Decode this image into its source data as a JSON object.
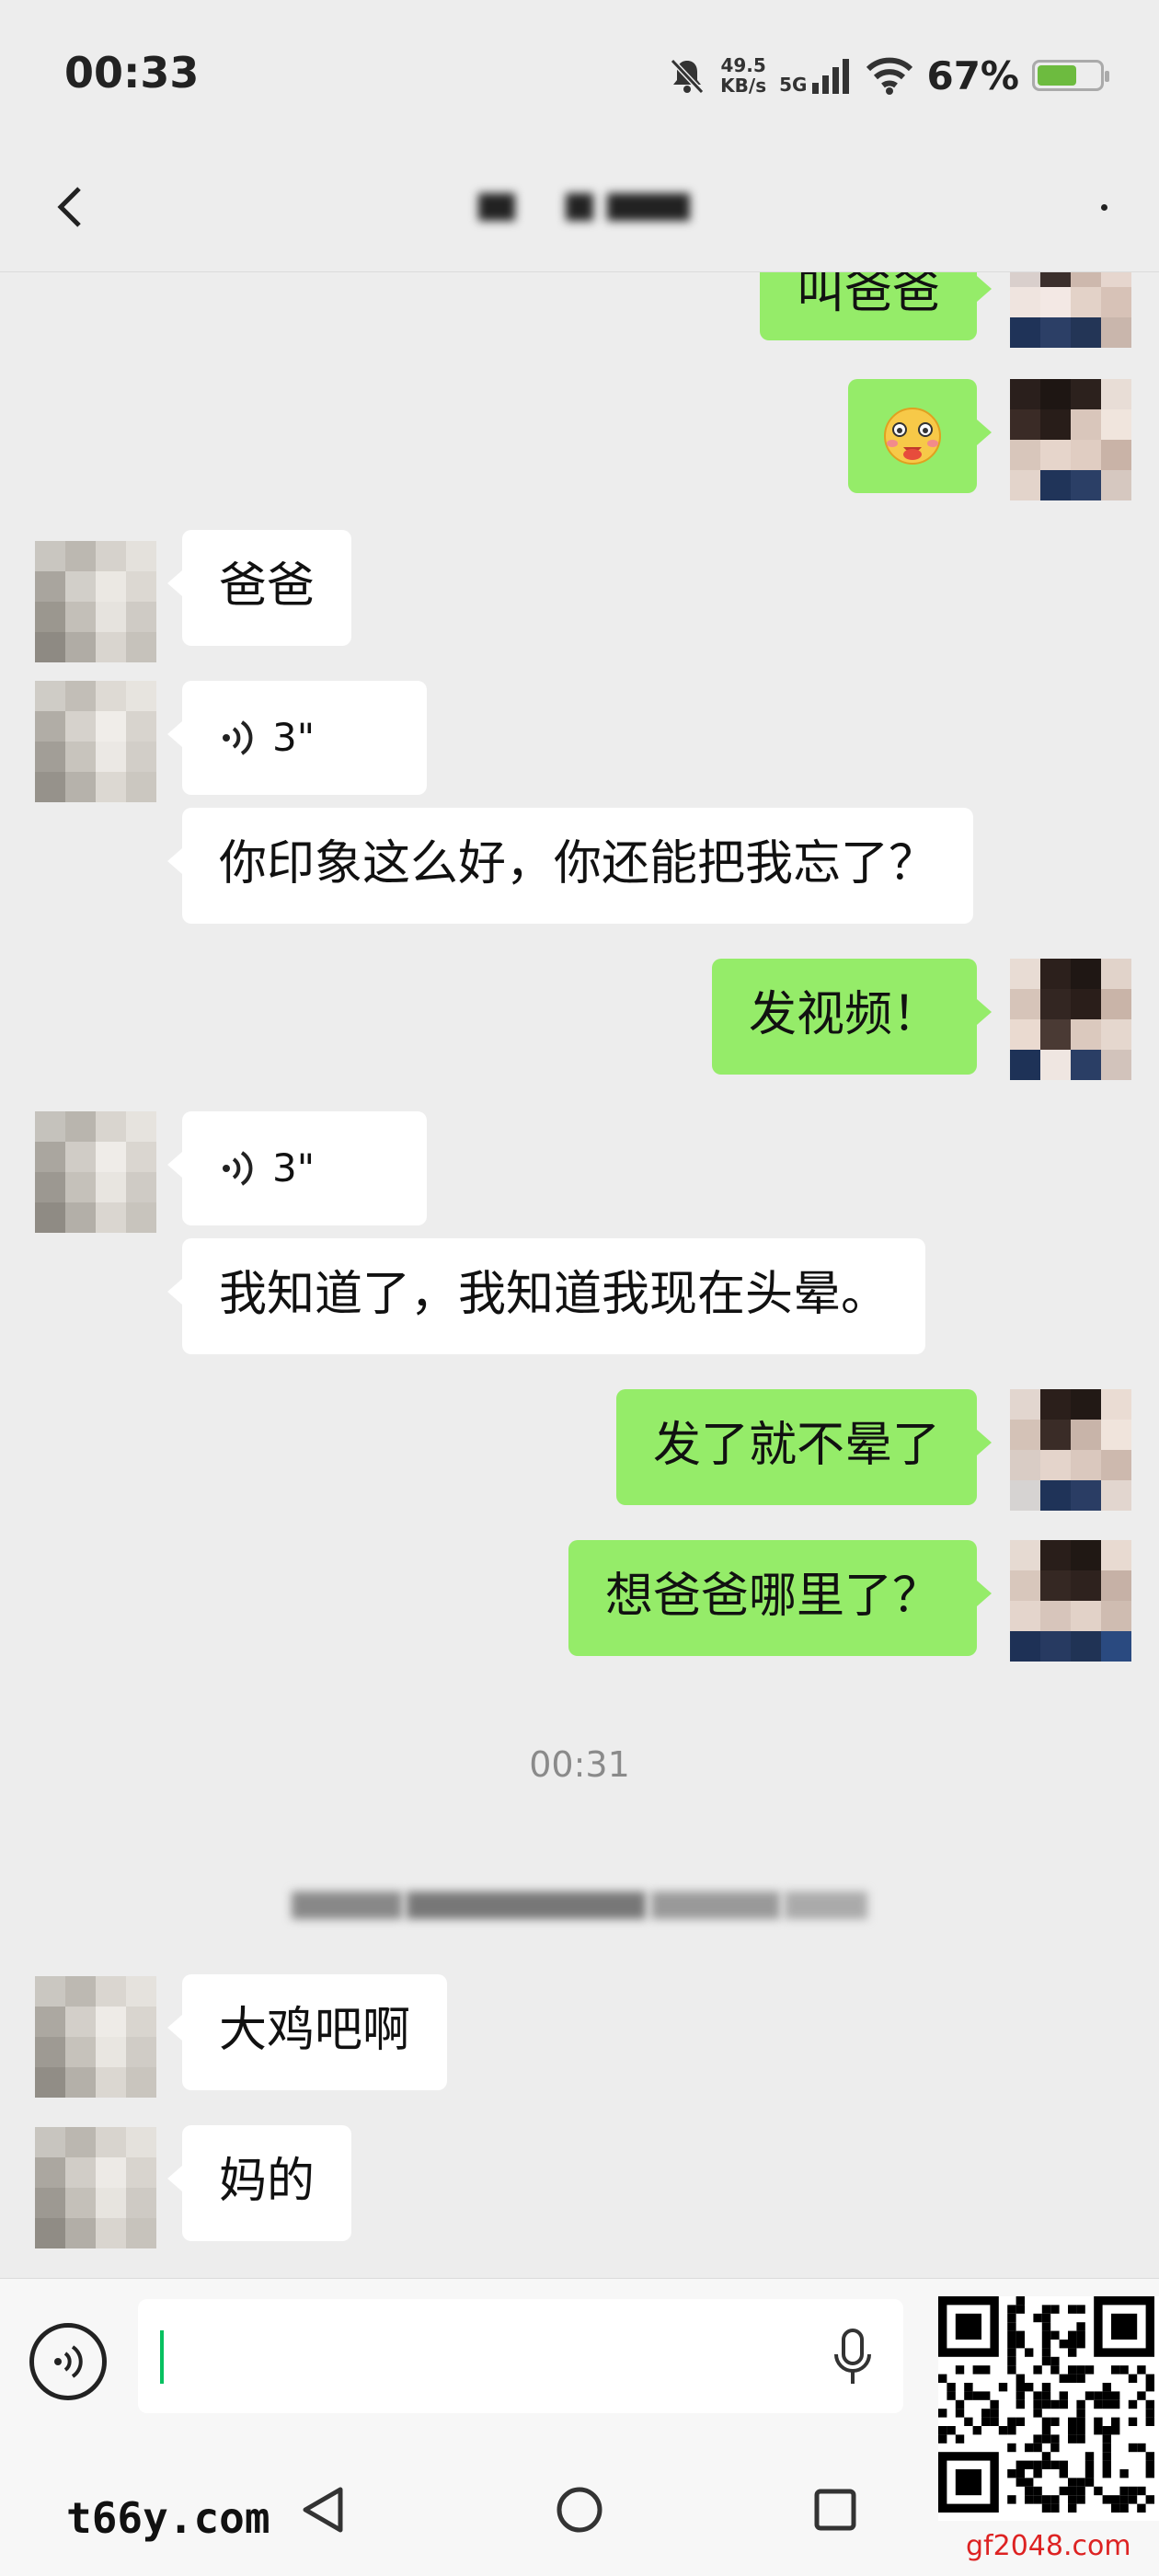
{
  "status_bar": {
    "time": "00:33",
    "net_speed_value": "49.5",
    "net_speed_unit": "KB/s",
    "network": "5G",
    "battery": "67%",
    "battery_level": 0.67,
    "icons": [
      "mute-bell-icon",
      "signal-icon",
      "wifi-icon",
      "battery-icon"
    ]
  },
  "header": {
    "back_icon": "chevron-left-icon",
    "more_icon": "more-dot-icon"
  },
  "messages": [
    {
      "side": "out",
      "type": "text",
      "text": "叫爸爸"
    },
    {
      "side": "out",
      "type": "emoji",
      "icon": "blushing-emoji-icon"
    },
    {
      "side": "in",
      "type": "text",
      "text": "爸爸"
    },
    {
      "side": "in",
      "type": "voice",
      "duration": "3\""
    },
    {
      "side": "in",
      "type": "text",
      "text": "你印象这么好，你还能把我忘了？"
    },
    {
      "side": "out",
      "type": "text",
      "text": "发视频！"
    },
    {
      "side": "in",
      "type": "voice",
      "duration": "3\""
    },
    {
      "side": "in",
      "type": "text",
      "text": "我知道了，我知道我现在头晕。"
    },
    {
      "side": "out",
      "type": "text",
      "text": "发了就不晕了"
    },
    {
      "side": "out",
      "type": "text",
      "text": "想爸爸哪里了？"
    },
    {
      "type": "timestamp",
      "text": "00:31"
    },
    {
      "side": "in",
      "type": "text",
      "text": "大鸡吧啊"
    },
    {
      "side": "in",
      "type": "text",
      "text": "妈的"
    }
  ],
  "input_bar": {
    "voice_toggle_icon": "voice-toggle-icon",
    "mic_icon": "microphone-icon"
  },
  "system_nav": {
    "icons": [
      "back-triangle-icon",
      "home-circle-icon",
      "recents-square-icon"
    ]
  },
  "watermark": {
    "site_text": "t66y.com",
    "qr_caption": "gf2048.com"
  },
  "colors": {
    "background": "#ededed",
    "outgoing_bubble": "#95ec69",
    "incoming_bubble": "#ffffff",
    "accent": "#07c160"
  }
}
